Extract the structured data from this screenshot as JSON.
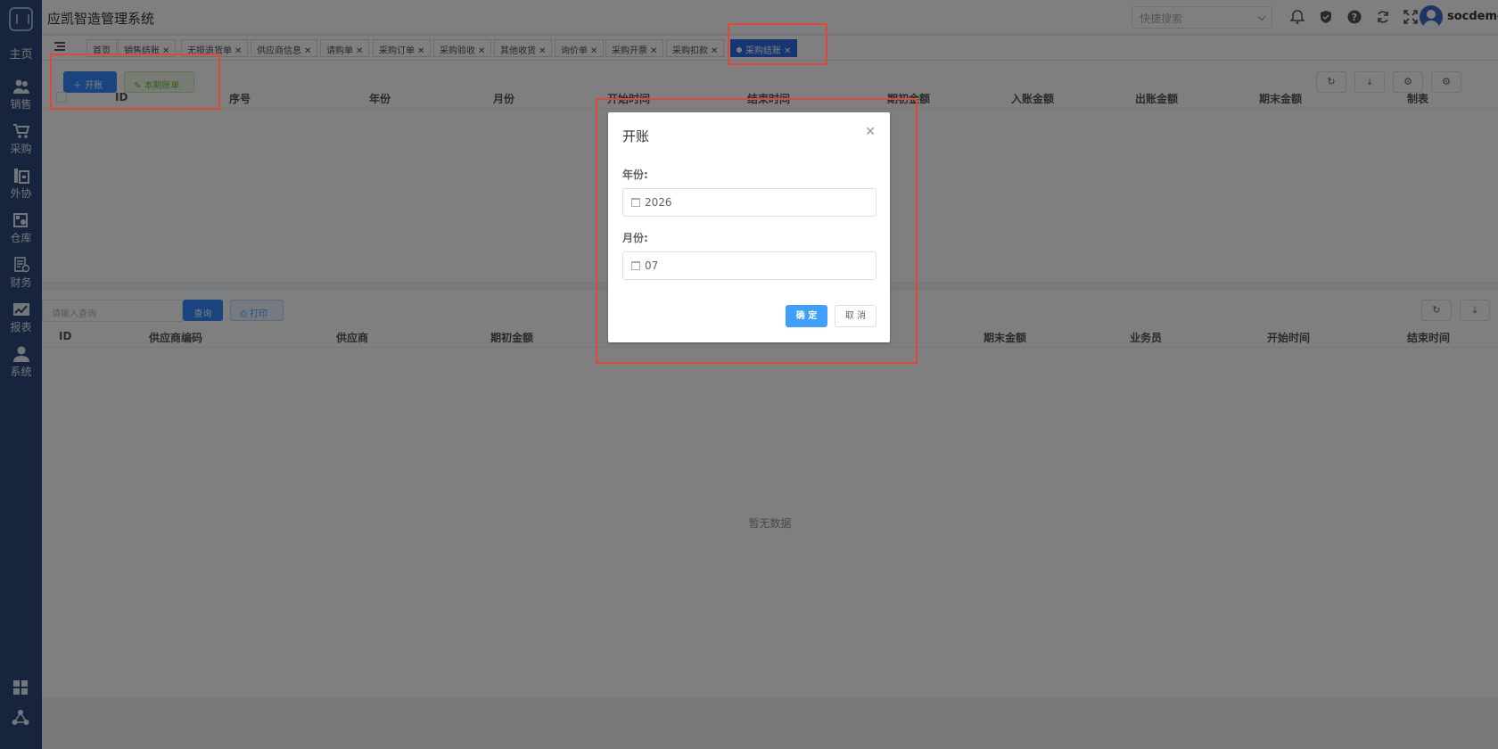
{
  "app": {
    "title": "应凯智造管理系统"
  },
  "sidebar": {
    "home": "主页",
    "items": [
      {
        "label": "销售",
        "icon": "users-icon"
      },
      {
        "label": "采购",
        "icon": "cart-icon"
      },
      {
        "label": "外协",
        "icon": "factory-icon"
      },
      {
        "label": "仓库",
        "icon": "warehouse-icon"
      },
      {
        "label": "财务",
        "icon": "finance-icon"
      },
      {
        "label": "报表",
        "icon": "chart-icon"
      },
      {
        "label": "系统",
        "icon": "user-icon"
      }
    ]
  },
  "header": {
    "search_placeholder": "快捷搜索",
    "username": "socdemo",
    "icons": [
      "bell-icon",
      "shield-icon",
      "help-icon",
      "refresh-icon",
      "fullscreen-icon"
    ]
  },
  "tabs": [
    {
      "label": "首页",
      "closable": false
    },
    {
      "label": "销售结账",
      "closable": true
    },
    {
      "label": "无损退货单",
      "closable": true
    },
    {
      "label": "供应商信息",
      "closable": true
    },
    {
      "label": "请购单",
      "closable": true
    },
    {
      "label": "采购订单",
      "closable": true
    },
    {
      "label": "采购验收",
      "closable": true
    },
    {
      "label": "其他收货",
      "closable": true
    },
    {
      "label": "询价单",
      "closable": true
    },
    {
      "label": "采购开票",
      "closable": true
    },
    {
      "label": "采购扣款",
      "closable": true
    },
    {
      "label": "采购结账",
      "closable": true,
      "active": true
    }
  ],
  "top_panel": {
    "open_button": "开账",
    "current_bill_button": "本期账单",
    "columns": [
      "ID",
      "序号",
      "年份",
      "月份",
      "开始时间",
      "结束时间",
      "期初金额",
      "入账金额",
      "出账金额",
      "期末金额",
      "制表"
    ]
  },
  "bottom_panel": {
    "query_placeholder": "请输入查询",
    "query_button": "查询",
    "print_button": "打印",
    "columns": [
      "ID",
      "供应商编码",
      "供应商",
      "期初金额",
      "期末金额",
      "业务员",
      "开始时间",
      "结束时间"
    ],
    "empty_text": "暂无数据"
  },
  "dialog": {
    "title": "开账",
    "year_label": "年份:",
    "year_value": "2026",
    "month_label": "月份:",
    "month_value": "07",
    "ok_button": "确 定",
    "cancel_button": "取 消"
  },
  "colors": {
    "sidebar": "#2d4a7a",
    "primary": "#3388ff",
    "active_tab": "#2b6de5",
    "highlight": "#e0463a"
  }
}
